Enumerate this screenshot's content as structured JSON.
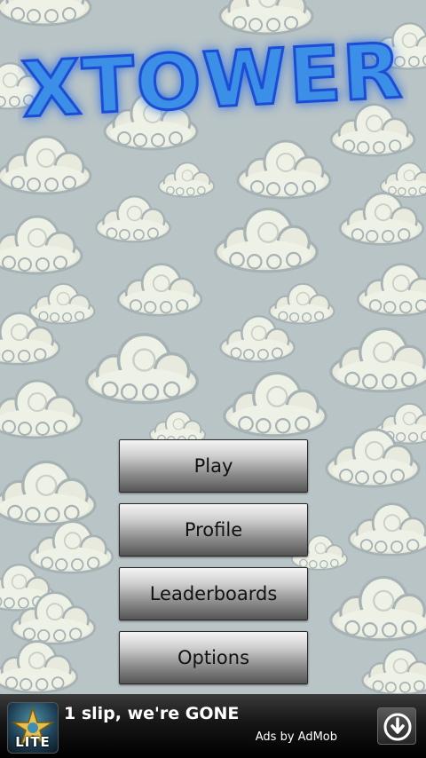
{
  "game": {
    "title": "XTOWER"
  },
  "menu": {
    "items": [
      {
        "label": "Play"
      },
      {
        "label": "Profile"
      },
      {
        "label": "Leaderboards"
      },
      {
        "label": "Options"
      }
    ]
  },
  "ad": {
    "icon_label": "LITE",
    "headline": "1 slip, we're GONE",
    "attribution": "Ads by AdMob",
    "download_icon": "download-icon"
  },
  "colors": {
    "background": "#b9c4c6",
    "title_blue": "#3b8fe6",
    "title_glow": "#1c4bd6",
    "cloud_fill": "#eef1e6"
  }
}
